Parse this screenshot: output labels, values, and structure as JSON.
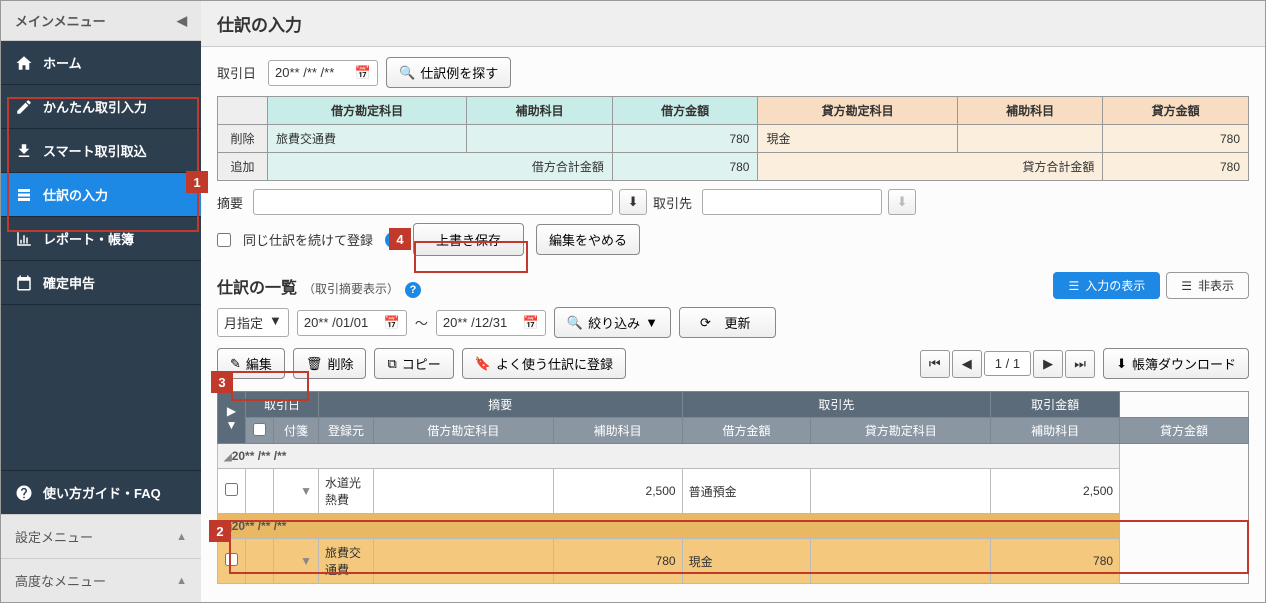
{
  "sidebar": {
    "header": "メインメニュー",
    "items": [
      {
        "label": "ホーム"
      },
      {
        "label": "かんたん取引入力"
      },
      {
        "label": "スマート取引取込"
      },
      {
        "label": "仕訳の入力"
      },
      {
        "label": "レポート・帳簿"
      },
      {
        "label": "確定申告"
      }
    ],
    "faq": "使い方ガイド・FAQ",
    "sub1": "設定メニュー",
    "sub2": "高度なメニュー"
  },
  "page": {
    "title": "仕訳の入力"
  },
  "form": {
    "date_label": "取引日",
    "date_value": "20** /** /**",
    "find_label": "仕訳例を探す",
    "headers": {
      "debit_acct": "借方勘定科目",
      "debit_sub": "補助科目",
      "debit_amt": "借方金額",
      "credit_acct": "貸方勘定科目",
      "credit_sub": "補助科目",
      "credit_amt": "貸方金額"
    },
    "row_btns": {
      "delete": "削除",
      "add": "追加"
    },
    "row": {
      "debit_acct": "旅費交通費",
      "debit_amt": "780",
      "credit_acct": "現金",
      "credit_amt": "780"
    },
    "totals": {
      "debit_label": "借方合計金額",
      "debit_val": "780",
      "credit_label": "貸方合計金額",
      "credit_val": "780"
    },
    "summary_label": "摘要",
    "trader_label": "取引先",
    "repeat_label": "同じ仕訳を続けて登録",
    "save_label": "上書き保存",
    "cancel_label": "編集をやめる"
  },
  "list": {
    "title": "仕訳の一覧",
    "sub": "（取引摘要表示）",
    "view_show": "入力の表示",
    "view_hide": "非表示",
    "period_mode": "月指定",
    "from": "20** /01/01",
    "to": "20** /12/31",
    "tilde": "〜",
    "filter": "絞り込み",
    "refresh": "更新",
    "edit": "編集",
    "delete": "削除",
    "copy": "コピー",
    "register": "よく使う仕訳に登録",
    "page_cur": "1",
    "page_sep": "/",
    "page_tot": "1",
    "download": "帳簿ダウンロード",
    "th": {
      "date": "取引日",
      "summary": "摘要",
      "trader": "取引先",
      "amount": "取引金額",
      "tag": "付箋",
      "source": "登録元",
      "deb_acct": "借方勘定科目",
      "deb_sub": "補助科目",
      "deb_amt": "借方金額",
      "cre_acct": "貸方勘定科目",
      "cre_sub": "補助科目",
      "cre_amt": "貸方金額"
    },
    "rows": [
      {
        "group": "20** /** /**",
        "deb_acct": "水道光熱費",
        "deb_amt": "2,500",
        "cre_acct": "普通預金",
        "cre_amt": "2,500",
        "selected": false
      },
      {
        "group": "20** /** /**",
        "deb_acct": "旅費交通費",
        "deb_amt": "780",
        "cre_acct": "現金",
        "cre_amt": "780",
        "selected": true
      }
    ]
  },
  "callouts": {
    "c1": "1",
    "c2": "2",
    "c3": "3",
    "c4": "4"
  }
}
